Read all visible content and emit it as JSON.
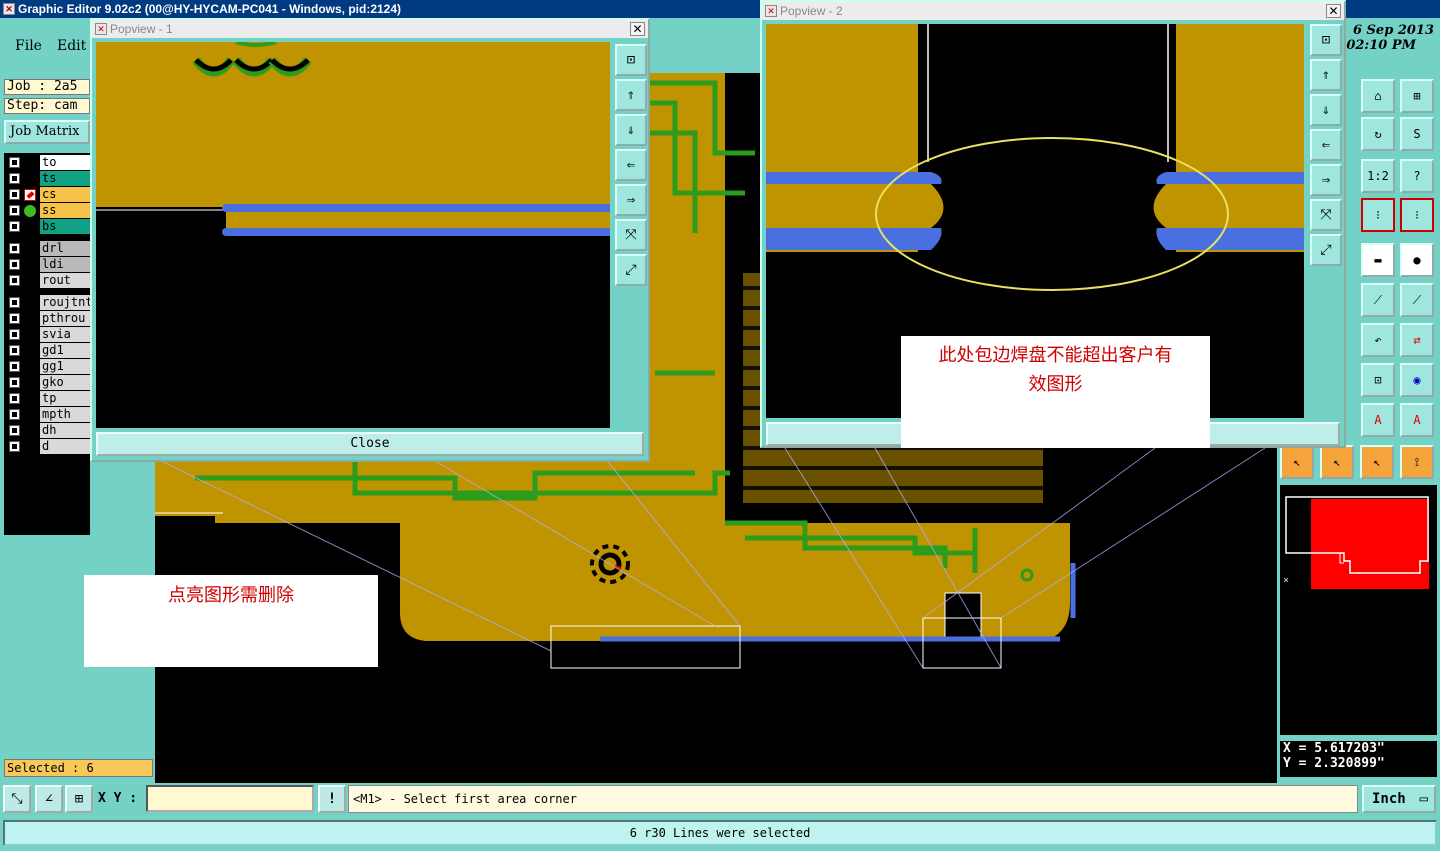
{
  "window": {
    "title": "Graphic Editor 9.02c2 (00@HY-HYCAM-PC041 - Windows, pid:2124)"
  },
  "menu": {
    "file": "File",
    "edit": "Edit"
  },
  "datetime": {
    "date": "6 Sep 2013",
    "time": "02:10 PM"
  },
  "job": {
    "job_label": "Job : 2a5",
    "step_label": "Step: cam",
    "matrix_button": "Job Matrix"
  },
  "layers": [
    {
      "name": "to",
      "color": "#ffffff",
      "mark": ""
    },
    {
      "name": "ts",
      "color": "#11a183",
      "mark": ""
    },
    {
      "name": "cs",
      "color": "#f5c24a",
      "mark": "edit"
    },
    {
      "name": "ss",
      "color": "#f5c24a",
      "mark": "display"
    },
    {
      "name": "bs",
      "color": "#11a183",
      "mark": ""
    },
    {
      "name": "drl",
      "color": "#b9b9b9",
      "mark": ""
    },
    {
      "name": "ldi",
      "color": "#b9b9b9",
      "mark": ""
    },
    {
      "name": "rout",
      "color": "#d9d9d9",
      "mark": ""
    },
    {
      "name": "roujtnt",
      "color": "#d9d9d9",
      "mark": ""
    },
    {
      "name": "pthrou",
      "color": "#d9d9d9",
      "mark": ""
    },
    {
      "name": "svia",
      "color": "#d9d9d9",
      "mark": ""
    },
    {
      "name": "gd1",
      "color": "#d9d9d9",
      "mark": ""
    },
    {
      "name": "gg1",
      "color": "#d9d9d9",
      "mark": ""
    },
    {
      "name": "gko",
      "color": "#d9d9d9",
      "mark": ""
    },
    {
      "name": "tp",
      "color": "#d9d9d9",
      "mark": ""
    },
    {
      "name": "mpth",
      "color": "#d9d9d9",
      "mark": ""
    },
    {
      "name": "dh",
      "color": "#d9d9d9",
      "mark": ""
    },
    {
      "name": "d",
      "color": "#d9d9d9",
      "mark": ""
    }
  ],
  "selected": "Selected : 6",
  "popview1": {
    "title": "Popview - 1",
    "close": "Close"
  },
  "popview2": {
    "title": "Popview - 2"
  },
  "notes": {
    "left": "点亮图形需删除",
    "right_line1": "此处包边焊盘不能超出客户有",
    "right_line2": "效图形"
  },
  "coords": {
    "x": "X = 5.617203\"",
    "y": "Y = 2.320899\""
  },
  "bottom": {
    "xy_label": "X Y :",
    "xy_value": "",
    "exclaim": "!",
    "prompt": "<M1> - Select first area corner",
    "units": "Inch"
  },
  "status": "6 r30 Lines were selected",
  "toolbar_icons": [
    "home-icon",
    "layout-icon",
    "rotate-icon",
    "mirror-icon",
    "scale-icon",
    "help-icon",
    "snap-icon",
    "snap2-icon",
    "ruler-icon",
    "pad-icon",
    "measure-icon",
    "measure2-icon",
    "undo-icon",
    "flip-icon",
    "zoom-icon",
    "shapes-icon",
    "attribute-icon",
    "attribute2-icon",
    "pointer-icon",
    "select-icon",
    "select2-icon",
    "route-icon"
  ]
}
